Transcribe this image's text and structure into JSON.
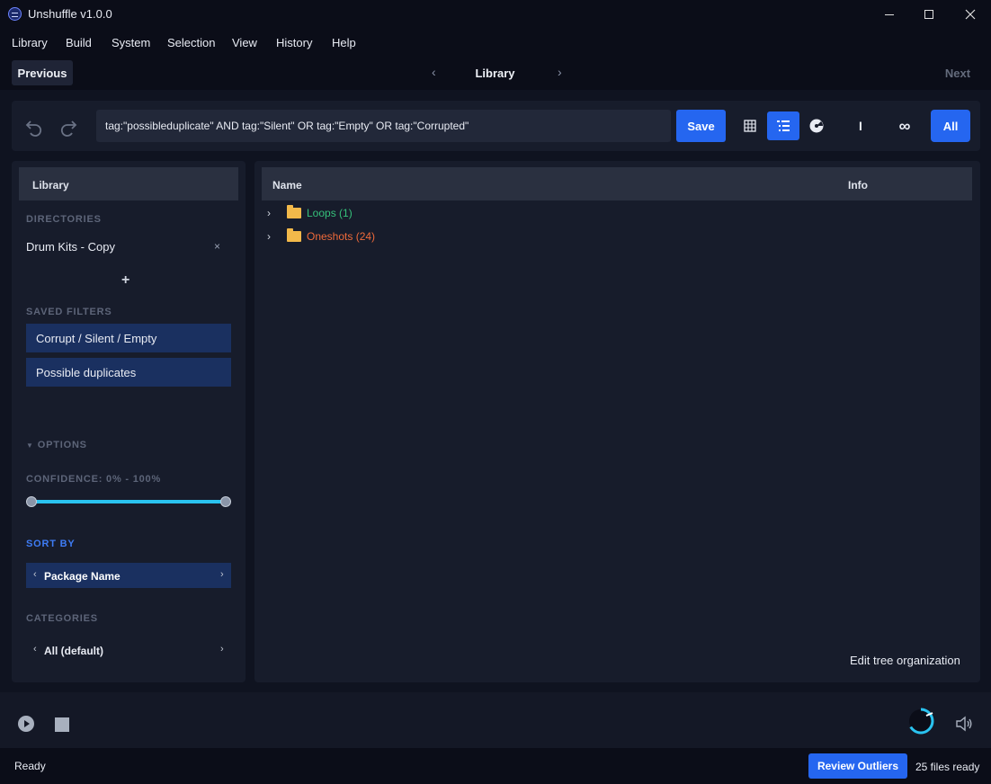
{
  "window": {
    "title": "Unshuffle v1.0.0"
  },
  "menu": [
    "Library",
    "Build",
    "System",
    "Selection",
    "View",
    "History",
    "Help"
  ],
  "nav": {
    "previous": "Previous",
    "title": "Library",
    "next": "Next",
    "left_arrow": "‹",
    "right_arrow": "›"
  },
  "toolbar": {
    "query": "tag:\"possibleduplicate\" AND tag:\"Silent\" OR tag:\"Empty\" OR tag:\"Corrupted\"",
    "save_label": "Save",
    "bar_label": "I",
    "infinity_label": "∞",
    "all_label": "All",
    "icons": [
      "undo-icon",
      "redo-icon",
      "grid-view-icon",
      "list-view-icon",
      "disc-icon"
    ]
  },
  "sidebar": {
    "header": "Library",
    "directories_label": "DIRECTORIES",
    "directories": [
      "Drum Kits - Copy"
    ],
    "add_label": "+",
    "remove_label": "×",
    "saved_filters_label": "SAVED FILTERS",
    "saved_filters": [
      "Corrupt / Silent / Empty",
      "Possible duplicates"
    ],
    "options_label": "OPTIONS",
    "confidence_label": "CONFIDENCE: 0% - 100%",
    "confidence_min": 0,
    "confidence_max": 100,
    "sort_by_label": "SORT BY",
    "sort_by_value": "Package Name",
    "categories_label": "CATEGORIES",
    "categories_value": "All (default)"
  },
  "tree": {
    "col_name": "Name",
    "col_info": "Info",
    "rows": [
      {
        "label": "Loops (1)",
        "color": "#35c07a"
      },
      {
        "label": "Oneshots (24)",
        "color": "#ef6a3a"
      }
    ],
    "edit_label": "Edit tree organization"
  },
  "status": {
    "text": "Ready",
    "review_label": "Review Outliers",
    "files_ready": "25 files ready"
  },
  "colors": {
    "accent": "#2566f0",
    "filter_bg": "#1a3060",
    "slider": "#2ac3f0"
  }
}
